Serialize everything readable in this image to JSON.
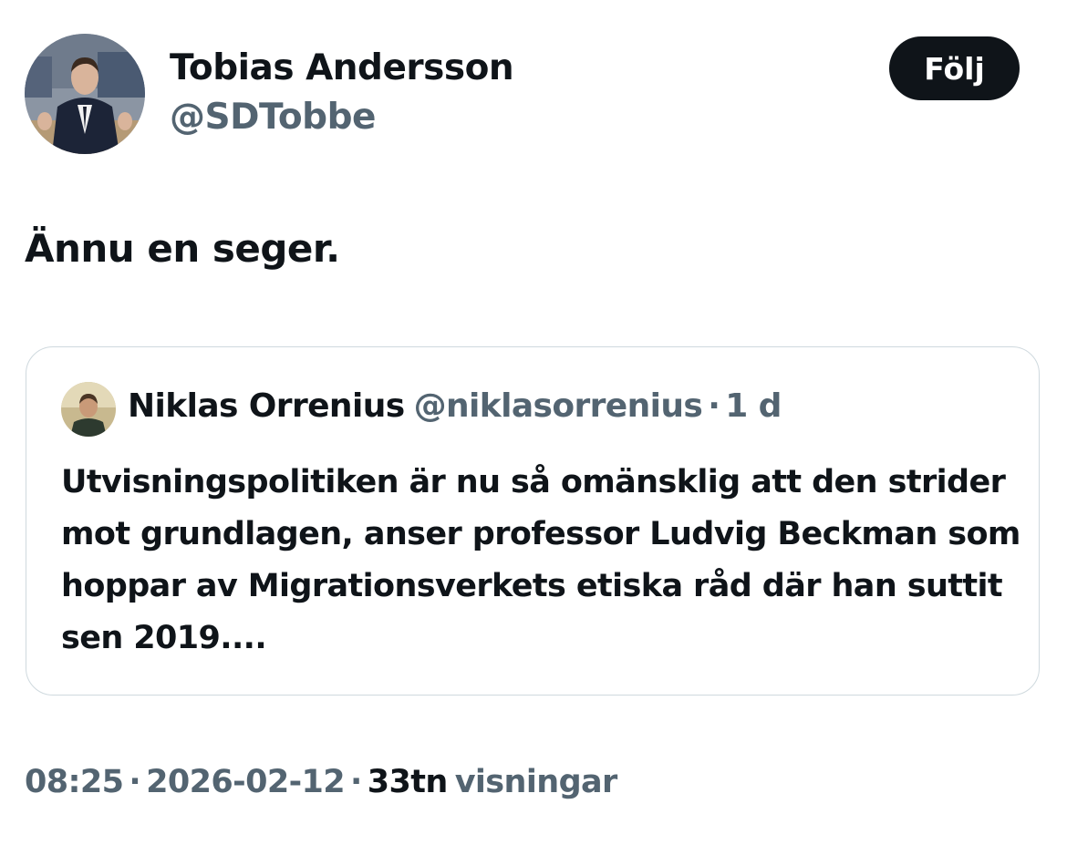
{
  "tweet": {
    "author": {
      "name": "Tobias Andersson",
      "handle": "@SDTobbe"
    },
    "follow_label": "Följ",
    "text": "Ännu en seger.",
    "quoted": {
      "name": "Niklas Orrenius",
      "handle": "@niklasorrenius",
      "separator": "·",
      "time": "1 d",
      "text": "Utvisningspolitiken är nu så omänsklig att den strider mot grundlagen, anser professor Ludvig Beckman som hoppar av Migrationsverkets etiska råd där han suttit sen 2019...."
    },
    "meta": {
      "time": "08:25",
      "separator": "·",
      "date": "2026-02-12",
      "views_count": "33tn",
      "views_label": "visningar"
    }
  },
  "colors": {
    "text_primary": "#0f1419",
    "text_secondary": "#536471",
    "border": "#cfd9de",
    "button_bg": "#0f1419",
    "button_text": "#ffffff"
  },
  "icons": {
    "author_avatar": "avatar-photo",
    "quoted_avatar": "avatar-photo"
  }
}
